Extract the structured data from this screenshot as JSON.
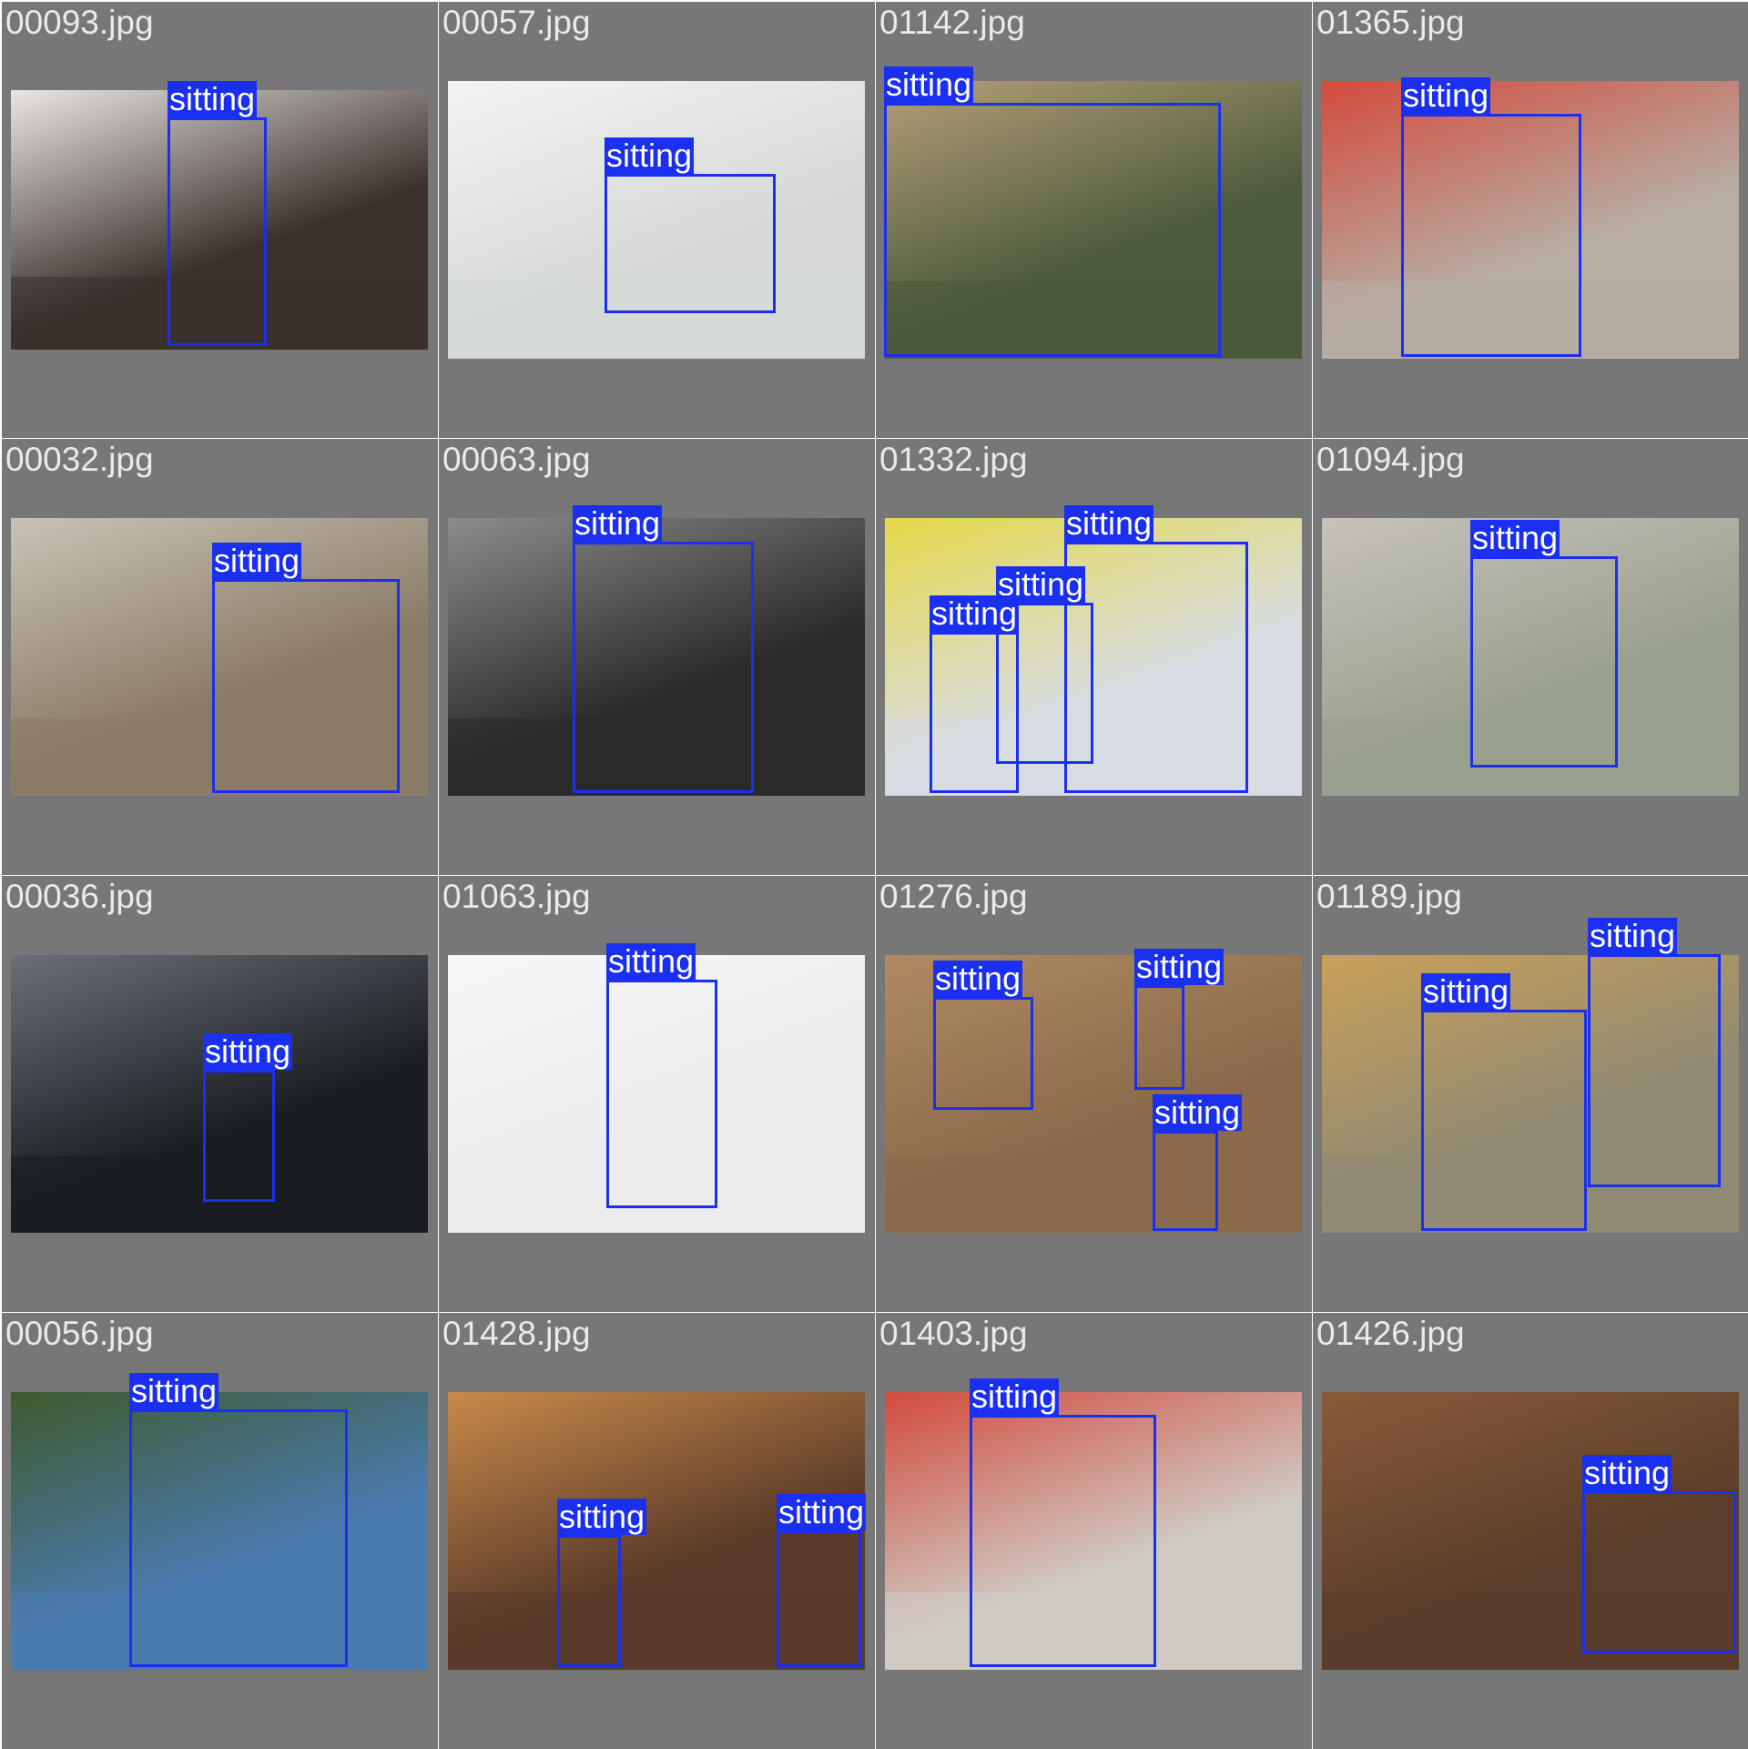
{
  "colors": {
    "tile_bg": "#777777",
    "box": "#1a2ff0",
    "label_text": "#ffffff",
    "filename_text": "#eaeaea"
  },
  "tiles": [
    {
      "file": "00093.jpg",
      "palette": [
        "#3b302c",
        "#e9e7e2"
      ],
      "detections": [
        {
          "label": "sitting"
        }
      ]
    },
    {
      "file": "00057.jpg",
      "palette": [
        "#d6d9d8",
        "#f3f4f2"
      ],
      "detections": [
        {
          "label": "sitting"
        }
      ]
    },
    {
      "file": "01142.jpg",
      "palette": [
        "#4b5a3b",
        "#b59f7a"
      ],
      "detections": [
        {
          "label": "sitting"
        }
      ]
    },
    {
      "file": "01365.jpg",
      "palette": [
        "#b7ada3",
        "#d24b3c"
      ],
      "detections": [
        {
          "label": "sitting"
        }
      ]
    },
    {
      "file": "00032.jpg",
      "palette": [
        "#8a7b66",
        "#c9c3b6"
      ],
      "detections": [
        {
          "label": "sitting"
        }
      ]
    },
    {
      "file": "00063.jpg",
      "palette": [
        "#2a2a2a",
        "#8c8c8c"
      ],
      "detections": [
        {
          "label": "sitting"
        }
      ]
    },
    {
      "file": "01332.jpg",
      "palette": [
        "#d8dde3",
        "#e5d94a"
      ],
      "detections": [
        {
          "label": "sitting"
        },
        {
          "label": "sitting"
        },
        {
          "label": "sitting"
        }
      ]
    },
    {
      "file": "01094.jpg",
      "palette": [
        "#9aa08f",
        "#c7c3bb"
      ],
      "detections": [
        {
          "label": "sitting"
        }
      ]
    },
    {
      "file": "00036.jpg",
      "palette": [
        "#1a1d22",
        "#6a7078"
      ],
      "detections": [
        {
          "label": "sitting"
        }
      ]
    },
    {
      "file": "01063.jpg",
      "palette": [
        "#ececec",
        "#f7f7f7"
      ],
      "detections": [
        {
          "label": "sitting"
        }
      ]
    },
    {
      "file": "01276.jpg",
      "palette": [
        "#8a6a4b",
        "#b08a62"
      ],
      "detections": [
        {
          "label": "sitting"
        },
        {
          "label": "sitting"
        },
        {
          "label": "sitting"
        }
      ]
    },
    {
      "file": "01189.jpg",
      "palette": [
        "#8f8a74",
        "#c9a058"
      ],
      "detections": [
        {
          "label": "sitting"
        },
        {
          "label": "sitting"
        }
      ]
    },
    {
      "file": "00056.jpg",
      "palette": [
        "#4a7bb0",
        "#3f5a2e"
      ],
      "detections": [
        {
          "label": "sitting"
        }
      ]
    },
    {
      "file": "01428.jpg",
      "palette": [
        "#5a3a28",
        "#c98a4a"
      ],
      "detections": [
        {
          "label": "sitting"
        },
        {
          "label": "sitting"
        }
      ]
    },
    {
      "file": "01403.jpg",
      "palette": [
        "#cfcac4",
        "#d24b3c"
      ],
      "detections": [
        {
          "label": "sitting"
        }
      ]
    },
    {
      "file": "01426.jpg",
      "palette": [
        "#5a3d2a",
        "#8a5a3a"
      ],
      "detections": [
        {
          "label": "sitting"
        }
      ]
    }
  ]
}
